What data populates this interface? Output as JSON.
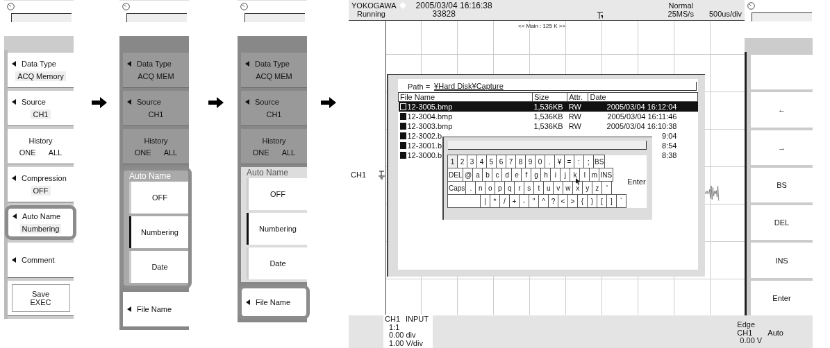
{
  "steps": [
    {
      "dimmed": false,
      "items": [
        {
          "kind": "select",
          "label": "Data Type",
          "value": "ACQ Memory",
          "highlighted": false
        },
        {
          "kind": "select",
          "label": "Source",
          "value": "CH1",
          "highlighted": false
        },
        {
          "kind": "options",
          "label": "History",
          "options": [
            "ONE",
            "ALL"
          ],
          "highlighted": false
        },
        {
          "kind": "select",
          "label": "Compression",
          "value": "OFF",
          "highlighted": false
        },
        {
          "kind": "select",
          "label": "Auto Name",
          "value": "Numbering",
          "highlighted": true
        },
        {
          "kind": "plain",
          "label": "Comment",
          "highlighted": false
        },
        {
          "kind": "exec",
          "label": "Save\nEXEC",
          "highlighted": false
        }
      ]
    },
    {
      "dimmed": true,
      "items": [
        {
          "kind": "select",
          "label": "Data Type",
          "value": "ACQ MEM",
          "highlighted": false
        },
        {
          "kind": "select",
          "label": "Source",
          "value": "CH1",
          "highlighted": false
        },
        {
          "kind": "options",
          "label": "History",
          "options": [
            "ONE",
            "ALL"
          ],
          "highlighted": false
        },
        {
          "kind": "popup",
          "title": "Auto Name",
          "options": [
            {
              "label": "OFF",
              "selected": false
            },
            {
              "label": "Numbering",
              "selected": true
            },
            {
              "label": "Date",
              "selected": false
            }
          ],
          "highlighted": true
        },
        {
          "kind": "plain",
          "label": "File Name",
          "highlighted": false
        }
      ]
    },
    {
      "dimmed": true,
      "items": [
        {
          "kind": "select",
          "label": "Data Type",
          "value": "ACQ MEM",
          "highlighted": false
        },
        {
          "kind": "select",
          "label": "Source",
          "value": "CH1",
          "highlighted": false
        },
        {
          "kind": "options",
          "label": "History",
          "options": [
            "ONE",
            "ALL"
          ],
          "highlighted": false
        },
        {
          "kind": "popup",
          "title": "Auto Name",
          "options": [
            {
              "label": "OFF",
              "selected": false
            },
            {
              "label": "Numbering",
              "selected": true
            },
            {
              "label": "Date",
              "selected": false
            }
          ],
          "highlighted": false
        },
        {
          "kind": "plain",
          "label": "File Name",
          "highlighted": true
        }
      ]
    }
  ],
  "scope": {
    "header": {
      "brand": "YOKOGAWA",
      "status": "Running",
      "datetime": "2005/03/04 16:16:38",
      "count": "33828",
      "mode": "Normal",
      "sample_rate": "25MS/s",
      "timebase": "500us/div"
    },
    "zoom_label": "<< Main : 125 K >>",
    "channel_label": "CH1",
    "dialog": {
      "path_label": "Path =",
      "path": "¥Hard Disk¥Capture",
      "columns": [
        "File Name",
        "Size",
        "Attr.",
        "Date"
      ],
      "rows": [
        {
          "name": "12-3005.bmp",
          "size": "1,536KB",
          "attr": "RW",
          "date": "2005/03/04 16:12:04",
          "selected": true
        },
        {
          "name": "12-3004.bmp",
          "size": "1,536KB",
          "attr": "RW",
          "date": "2005/03/04 16:11:46",
          "selected": false
        },
        {
          "name": "12-3003.bmp",
          "size": "1,536KB",
          "attr": "RW",
          "date": "2005/03/04 16:10:38",
          "selected": false
        },
        {
          "name": "12-3002.b",
          "date": "9:04",
          "selected": false
        },
        {
          "name": "12-3001.b",
          "date": "8:54",
          "selected": false
        },
        {
          "name": "12-3000.b",
          "date": "8:38",
          "selected": false
        }
      ]
    },
    "keyboard": {
      "rows": [
        {
          "kind": "plain",
          "keys": [
            "1",
            "2",
            "3",
            "4",
            "5",
            "6",
            "7",
            "8",
            "9",
            "0",
            ".",
            "¥",
            "=",
            ":",
            ";",
            "BS"
          ]
        },
        {
          "kind": "plain",
          "keys": [
            "DEL",
            "@",
            "a",
            "b",
            "c",
            "d",
            "e",
            "f",
            "g",
            "h",
            "i",
            "j",
            "k",
            "l",
            "m",
            "INS"
          ]
        },
        {
          "kind": "plain",
          "keys": [
            "Caps",
            ".",
            "n",
            "o",
            "p",
            "q",
            "r",
            "s",
            "t",
            "u",
            "v",
            "w",
            "x",
            "y",
            "z",
            "'"
          ]
        },
        {
          "kind": "indented",
          "keys": [
            "|",
            "*",
            "/",
            "+",
            "-",
            "\"",
            "^",
            "?",
            "<",
            ">",
            "{",
            "}",
            "[",
            "]",
            "`"
          ]
        }
      ],
      "enter": "Enter"
    },
    "status": {
      "channel": "CH1",
      "coupling": "INPUT",
      "lines": [
        "1:1",
        "0.00 div",
        "1.00 V/div"
      ],
      "trigger_type": "Edge",
      "trigger_source": "CH1",
      "trigger_mode": "Auto",
      "trigger_level": "0.00 V"
    }
  },
  "soft_keys": [
    {
      "kind": "blank"
    },
    {
      "kind": "key",
      "label": "←"
    },
    {
      "kind": "key",
      "label": "→"
    },
    {
      "kind": "key",
      "label": "BS"
    },
    {
      "kind": "key",
      "label": "DEL"
    },
    {
      "kind": "key",
      "label": "INS"
    },
    {
      "kind": "key",
      "label": "Enter"
    }
  ]
}
